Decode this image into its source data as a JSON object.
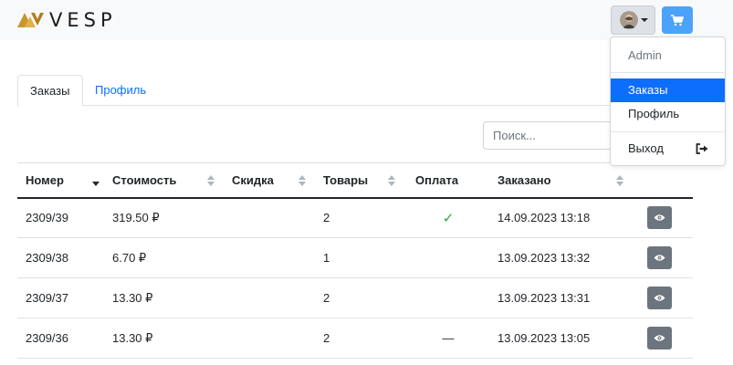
{
  "brand": {
    "name": "VESP"
  },
  "icons": {
    "logo": "vesp-logo",
    "cart": "cart-icon",
    "avatar": "user-avatar",
    "view": "eye-icon",
    "logout": "sign-out-icon",
    "paid": "check-icon"
  },
  "colors": {
    "primary": "#0d6efd",
    "cart_button": "#4aa3f8",
    "view_button": "#6c757d",
    "paid_check": "#28a745",
    "navbar": "#f8f9fa"
  },
  "tabs": [
    {
      "label": "Заказы",
      "active": true
    },
    {
      "label": "Профиль",
      "active": false
    }
  ],
  "search": {
    "placeholder": "Поиск...",
    "value": ""
  },
  "table": {
    "columns": [
      "Номер",
      "Стоимость",
      "Скидка",
      "Товары",
      "Оплата",
      "Заказано"
    ],
    "rows": [
      {
        "number": "2309/39",
        "cost": "319.50 ₽",
        "discount": "",
        "items": "2",
        "payment": "✓",
        "ordered": "14.09.2023 13:18"
      },
      {
        "number": "2309/38",
        "cost": "6.70 ₽",
        "discount": "",
        "items": "1",
        "payment": "",
        "ordered": "13.09.2023 13:32"
      },
      {
        "number": "2309/37",
        "cost": "13.30 ₽",
        "discount": "",
        "items": "2",
        "payment": "",
        "ordered": "13.09.2023 13:31"
      },
      {
        "number": "2309/36",
        "cost": "13.30 ₽",
        "discount": "",
        "items": "2",
        "payment": "—",
        "ordered": "13.09.2023 13:05"
      }
    ]
  },
  "dropdown": {
    "header": "Admin",
    "items": [
      {
        "label": "Заказы",
        "active": true
      },
      {
        "label": "Профиль",
        "active": false
      },
      {
        "label": "Выход",
        "active": false
      }
    ]
  }
}
